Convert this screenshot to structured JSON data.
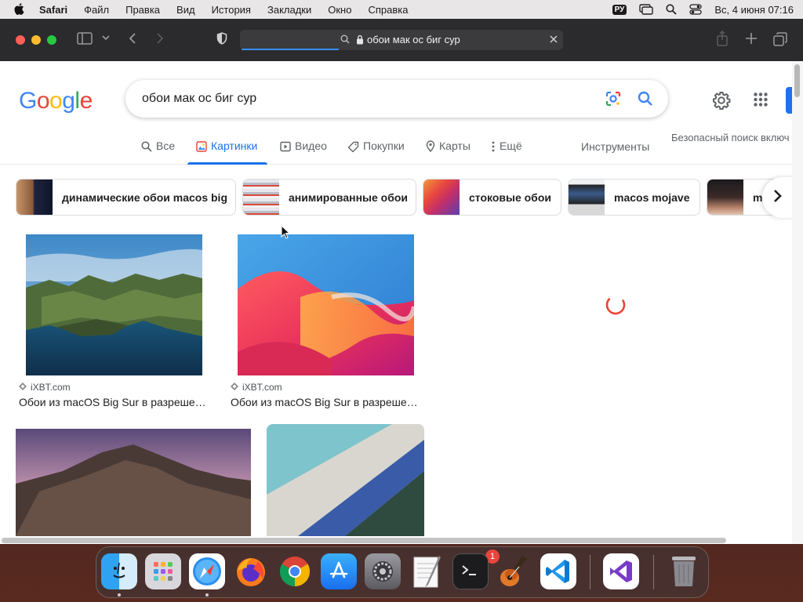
{
  "menubar": {
    "app_name": "Safari",
    "items": [
      "Файл",
      "Правка",
      "Вид",
      "История",
      "Закладки",
      "Окно",
      "Справка"
    ],
    "input_lang": "РУ",
    "datetime": "Вс, 4 июня  07:16"
  },
  "browser": {
    "url": "обои мак ос биг сур",
    "traffic_colors": [
      "#ff5f57",
      "#febc2e",
      "#28c840"
    ]
  },
  "google": {
    "query": "обои мак ос биг сур",
    "tabs": [
      {
        "label": "Все",
        "icon": "search-icon"
      },
      {
        "label": "Картинки",
        "icon": "image-icon",
        "active": true
      },
      {
        "label": "Видео",
        "icon": "video-icon"
      },
      {
        "label": "Покупки",
        "icon": "tag-icon"
      },
      {
        "label": "Карты",
        "icon": "map-pin-icon"
      },
      {
        "label": "Ещё",
        "icon": "more-vert-icon"
      }
    ],
    "tools_label": "Инструменты",
    "safesearch": "Безопасный поиск включ",
    "chips": [
      "динамические обои macos big",
      "анимированные обои",
      "стоковые обои",
      "macos mojave",
      "m"
    ],
    "results": [
      {
        "source": "iXBT.com",
        "title": "Обои из macOS Big Sur в разреше…"
      },
      {
        "source": "iXBT.com",
        "title": "Обои из macOS Big Sur в разреше…"
      }
    ]
  },
  "dock": {
    "apps": [
      "finder-icon",
      "launchpad-icon",
      "safari-icon",
      "firefox-icon",
      "chrome-icon",
      "app-store-icon",
      "system-settings-icon",
      "textedit-icon",
      "terminal-icon",
      "garageband-icon",
      "vscode-icon",
      "visual-studio-icon",
      "trash-icon"
    ],
    "settings_badge": "1"
  }
}
